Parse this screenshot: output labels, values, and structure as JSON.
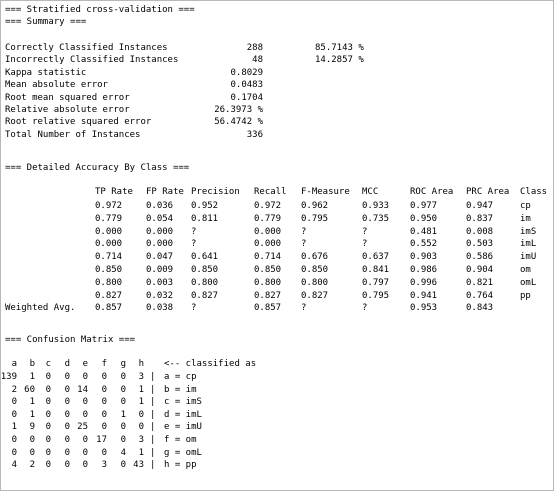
{
  "headers": {
    "cv": "=== Stratified cross-validation ===",
    "summary": "=== Summary ===",
    "detailed": "=== Detailed Accuracy By Class ===",
    "confusion": "=== Confusion Matrix ==="
  },
  "summary": [
    {
      "label": "Correctly Classified Instances",
      "v1": "288",
      "v2": "85.7143 %"
    },
    {
      "label": "Incorrectly Classified Instances",
      "v1": "48",
      "v2": "14.2857 %"
    },
    {
      "label": "Kappa statistic",
      "v1": "0.8029",
      "v2": ""
    },
    {
      "label": "Mean absolute error",
      "v1": "0.0483",
      "v2": ""
    },
    {
      "label": "Root mean squared error",
      "v1": "0.1704",
      "v2": ""
    },
    {
      "label": "Relative absolute error",
      "v1": "26.3973 %",
      "v2": ""
    },
    {
      "label": "Root relative squared error",
      "v1": "56.4742 %",
      "v2": ""
    },
    {
      "label": "Total Number of Instances",
      "v1": "336",
      "v2": ""
    }
  ],
  "accuracy": {
    "columns": [
      "TP Rate",
      "FP Rate",
      "Precision",
      "Recall",
      "F-Measure",
      "MCC",
      "ROC Area",
      "PRC Area",
      "Class"
    ],
    "rows": [
      {
        "label": "",
        "cells": [
          "0.972",
          "0.036",
          "0.952",
          "0.972",
          "0.962",
          "0.933",
          "0.977",
          "0.947",
          "cp"
        ]
      },
      {
        "label": "",
        "cells": [
          "0.779",
          "0.054",
          "0.811",
          "0.779",
          "0.795",
          "0.735",
          "0.950",
          "0.837",
          "im"
        ]
      },
      {
        "label": "",
        "cells": [
          "0.000",
          "0.000",
          "?",
          "0.000",
          "?",
          "?",
          "0.481",
          "0.008",
          "imS"
        ]
      },
      {
        "label": "",
        "cells": [
          "0.000",
          "0.000",
          "?",
          "0.000",
          "?",
          "?",
          "0.552",
          "0.503",
          "imL"
        ]
      },
      {
        "label": "",
        "cells": [
          "0.714",
          "0.047",
          "0.641",
          "0.714",
          "0.676",
          "0.637",
          "0.903",
          "0.586",
          "imU"
        ]
      },
      {
        "label": "",
        "cells": [
          "0.850",
          "0.009",
          "0.850",
          "0.850",
          "0.850",
          "0.841",
          "0.986",
          "0.904",
          "om"
        ]
      },
      {
        "label": "",
        "cells": [
          "0.800",
          "0.003",
          "0.800",
          "0.800",
          "0.800",
          "0.797",
          "0.996",
          "0.821",
          "omL"
        ]
      },
      {
        "label": "",
        "cells": [
          "0.827",
          "0.032",
          "0.827",
          "0.827",
          "0.827",
          "0.795",
          "0.941",
          "0.764",
          "pp"
        ]
      },
      {
        "label": "Weighted Avg.",
        "cells": [
          "0.857",
          "0.038",
          "?",
          "0.857",
          "?",
          "?",
          "0.953",
          "0.843",
          ""
        ]
      }
    ]
  },
  "confusion": {
    "header_cols": [
      "a",
      "b",
      "c",
      "d",
      "e",
      "f",
      "g",
      "h"
    ],
    "header_tail": "<-- classified as",
    "rows": [
      {
        "cells": [
          "139",
          "1",
          "0",
          "0",
          "0",
          "0",
          "0",
          "3"
        ],
        "sep": "|",
        "label": "a = cp"
      },
      {
        "cells": [
          "2",
          "60",
          "0",
          "0",
          "14",
          "0",
          "0",
          "1"
        ],
        "sep": "|",
        "label": "b = im"
      },
      {
        "cells": [
          "0",
          "1",
          "0",
          "0",
          "0",
          "0",
          "0",
          "1"
        ],
        "sep": "|",
        "label": "c = imS"
      },
      {
        "cells": [
          "0",
          "1",
          "0",
          "0",
          "0",
          "0",
          "1",
          "0"
        ],
        "sep": "|",
        "label": "d = imL"
      },
      {
        "cells": [
          "1",
          "9",
          "0",
          "0",
          "25",
          "0",
          "0",
          "0"
        ],
        "sep": "|",
        "label": "e = imU"
      },
      {
        "cells": [
          "0",
          "0",
          "0",
          "0",
          "0",
          "17",
          "0",
          "3"
        ],
        "sep": "|",
        "label": "f = om"
      },
      {
        "cells": [
          "0",
          "0",
          "0",
          "0",
          "0",
          "0",
          "4",
          "1"
        ],
        "sep": "|",
        "label": "g = omL"
      },
      {
        "cells": [
          "4",
          "2",
          "0",
          "0",
          "0",
          "3",
          "0",
          "43"
        ],
        "sep": "|",
        "label": "h = pp"
      }
    ]
  }
}
